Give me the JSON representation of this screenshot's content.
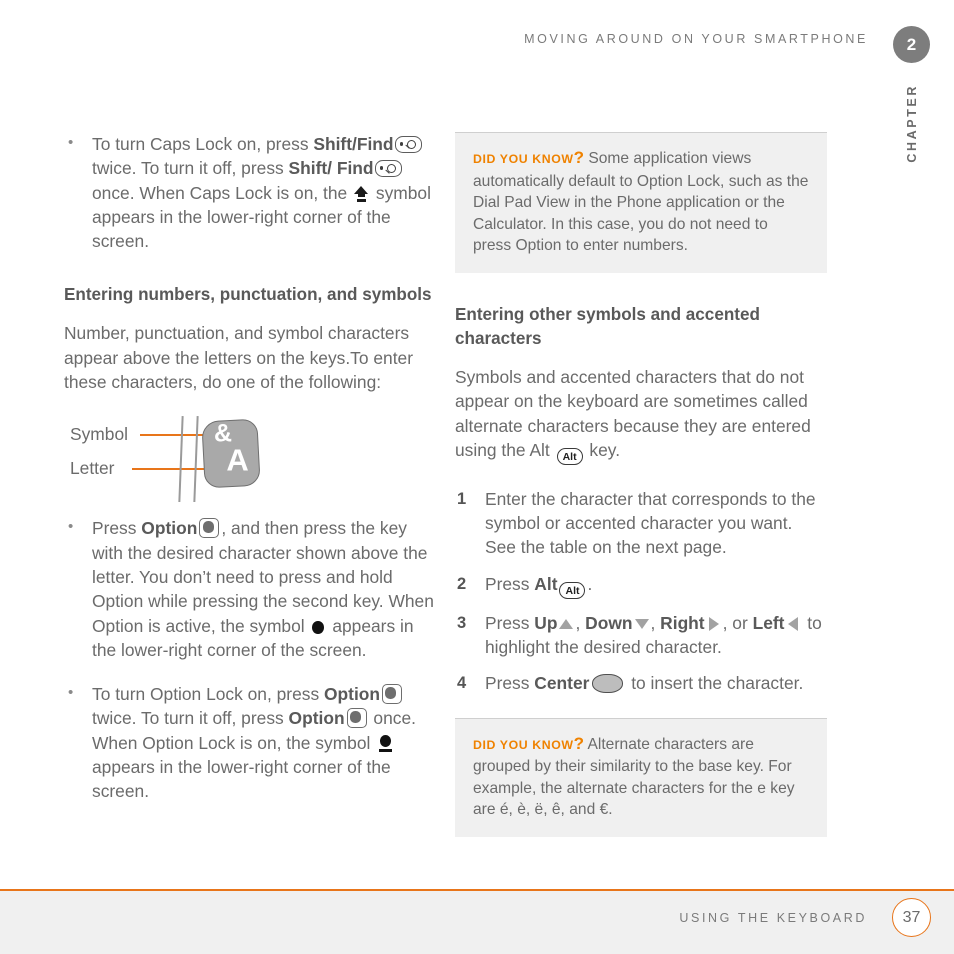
{
  "header": {
    "running_title": "Moving around on your smartphone",
    "chapter_number": "2",
    "chapter_word": "Chapter"
  },
  "footer": {
    "running_title": "Using the keyboard",
    "page_number": "37"
  },
  "colors": {
    "accent_orange": "#e8751a",
    "tag_orange": "#ef8200",
    "body_gray": "#6b6b6b",
    "heading_gray": "#595959",
    "box_background": "#f0f0f0",
    "key_gray": "#a9a9a9"
  },
  "left_column": {
    "caps_lock_bullet": {
      "part1": "To turn Caps Lock on, press ",
      "bold1": "Shift/Find",
      "part2": " twice. To turn it off, press ",
      "bold2": "Shift/ Find",
      "part3": " once. When Caps Lock is on, the ",
      "part4": " symbol appears in the lower-right corner of the screen."
    },
    "heading": "Entering numbers, punctuation, and symbols",
    "intro": "Number, punctuation, and symbol characters appear above the letters on the keys.To enter these characters, do one of the following:",
    "key_diagram": {
      "symbol_label": "Symbol",
      "letter_label": "Letter",
      "key_symbol_char": "&",
      "key_letter_char": "A"
    },
    "option_bullet": {
      "part1": "Press ",
      "bold1": "Option",
      "part2": ", and then press the key with the desired character shown above the letter. You don’t need to press and hold Option while pressing the second key. When Option is active, the symbol ",
      "part3": " appears in the lower-right corner of the screen."
    },
    "option_lock_bullet": {
      "part1": "To turn Option Lock on, press ",
      "bold1": "Option",
      "part2": " twice. To turn it off, press ",
      "bold2": "Option",
      "part3": " once. When Option Lock is on, the symbol ",
      "part4": " appears in the lower-right corner of the screen."
    }
  },
  "right_column": {
    "dyk_box_1": {
      "tag": "Did you know",
      "tag_mark": "?",
      "text": "Some application views automatically default to Option Lock, such as the Dial Pad View in the Phone application or the Calculator. In this case, you do not need to press Option to enter numbers."
    },
    "heading": "Entering other symbols and accented characters",
    "intro": {
      "part1": "Symbols and accented characters that do not appear on the keyboard are sometimes called alternate characters because they are entered using the Alt ",
      "part2": " key."
    },
    "steps": [
      {
        "num": "1",
        "text": "Enter the character that corresponds to the symbol or accented character you want. See the table on the next page."
      },
      {
        "num": "2",
        "prefix": "Press ",
        "bold": "Alt",
        "suffix": "."
      },
      {
        "num": "3",
        "prefix": "Press ",
        "bold_up": "Up",
        "sep1": ", ",
        "bold_down": "Down",
        "sep2": ", ",
        "bold_right": "Right",
        "sep3": ", or ",
        "bold_left": "Left",
        "suffix": " to highlight the desired character."
      },
      {
        "num": "4",
        "prefix": "Press ",
        "bold": "Center",
        "suffix": " to insert the character."
      }
    ],
    "dyk_box_2": {
      "tag": "Did you know",
      "tag_mark": "?",
      "text": "Alternate characters are grouped by their similarity to the base key. For example, the alternate characters for the e key are é, è, ë, ê, and €."
    },
    "alt_key_label": "Alt"
  },
  "icons": {
    "shift_find": "shift-find-key-icon",
    "caps_lock": "caps-lock-symbol-icon",
    "option_key": "option-key-icon",
    "option_symbol": "option-symbol-icon",
    "option_lock_symbol": "option-lock-symbol-icon",
    "alt_key": "alt-key-icon",
    "up_arrow": "up-triangle-icon",
    "down_arrow": "down-triangle-icon",
    "right_arrow": "right-triangle-icon",
    "left_arrow": "left-triangle-icon",
    "center_key": "center-key-icon"
  }
}
